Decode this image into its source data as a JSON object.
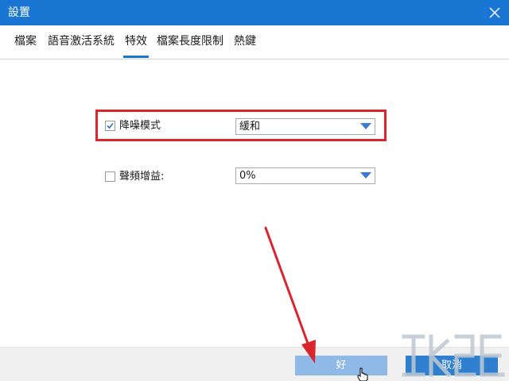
{
  "window": {
    "title": "設置",
    "close_icon": "close-icon"
  },
  "tabs": [
    {
      "label": "檔案",
      "active": false
    },
    {
      "label": "語音激活系統",
      "active": false
    },
    {
      "label": "特效",
      "active": true
    },
    {
      "label": "檔案長度限制",
      "active": false
    },
    {
      "label": "熱鍵",
      "active": false
    }
  ],
  "options": {
    "noise_reduction": {
      "label": "降噪模式",
      "checked": true,
      "selected": "緩和"
    },
    "gain": {
      "label": "聲頻增益:",
      "checked": false,
      "selected": "0%"
    }
  },
  "buttons": {
    "ok_label": "好",
    "cancel_label": "取消"
  },
  "colors": {
    "titlebar": "#1976d2",
    "highlight": "#d9252b",
    "ok_button": "#8fb9e6",
    "cancel_button": "#2f7fd0",
    "dropdown_arrow": "#3a7bd5"
  },
  "icons": {
    "dropdown": "triangle-down-icon",
    "checkbox": "checkmark-icon",
    "cursor": "hand-pointer-icon",
    "annotation": "red-arrow-icon"
  }
}
